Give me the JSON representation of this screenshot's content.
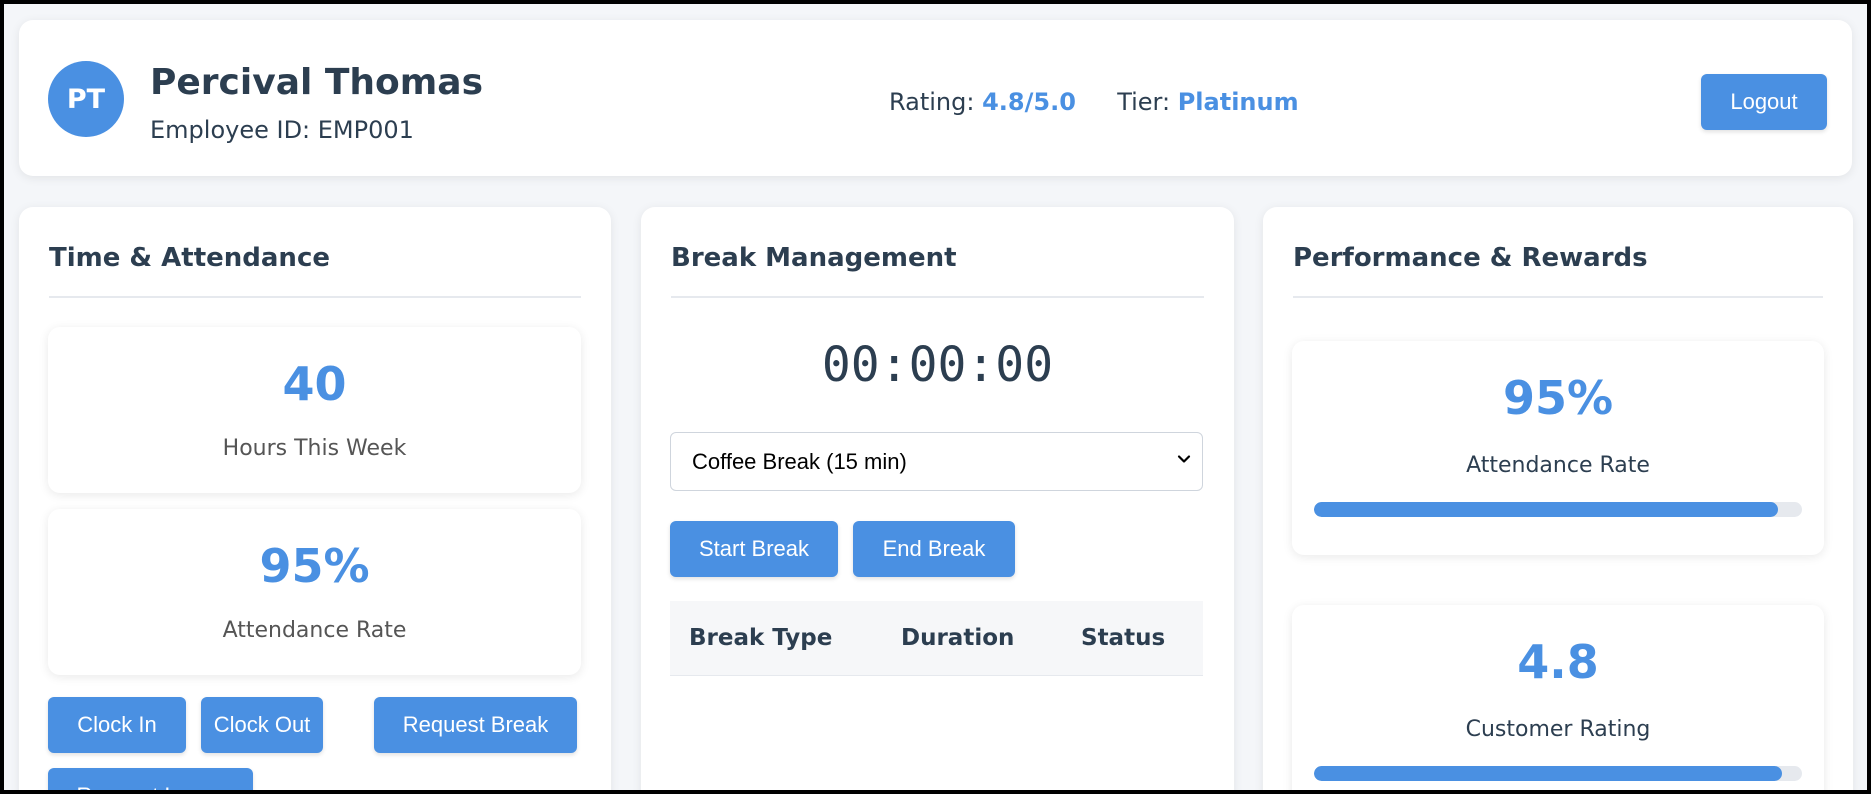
{
  "header": {
    "avatar_initials": "PT",
    "name": "Percival Thomas",
    "employee_id_label": "Employee ID: EMP001",
    "rating_label": "Rating:",
    "rating_value": "4.8/5.0",
    "tier_label": "Tier:",
    "tier_value": "Platinum",
    "logout_label": "Logout"
  },
  "attendance": {
    "title": "Time & Attendance",
    "hours_value": "40",
    "hours_label": "Hours This Week",
    "rate_value": "95%",
    "rate_label": "Attendance Rate",
    "buttons": {
      "clock_in": "Clock In",
      "clock_out": "Clock Out",
      "request_break": "Request Break",
      "request_leave": "Request Leave"
    }
  },
  "breaks": {
    "title": "Break Management",
    "timer": "00:00:00",
    "selected_type": "Coffee Break (15 min)",
    "start_label": "Start Break",
    "end_label": "End Break",
    "table_headers": [
      "Break Type",
      "Duration",
      "Status"
    ]
  },
  "performance": {
    "title": "Performance & Rewards",
    "attendance_value": "95%",
    "attendance_label": "Attendance Rate",
    "attendance_fraction": 0.95,
    "rating_value": "4.8",
    "rating_label": "Customer Rating",
    "rating_fraction": 0.96
  },
  "colors": {
    "accent": "#4a90e2",
    "text": "#2c3e50",
    "background": "#f4f6f9"
  }
}
